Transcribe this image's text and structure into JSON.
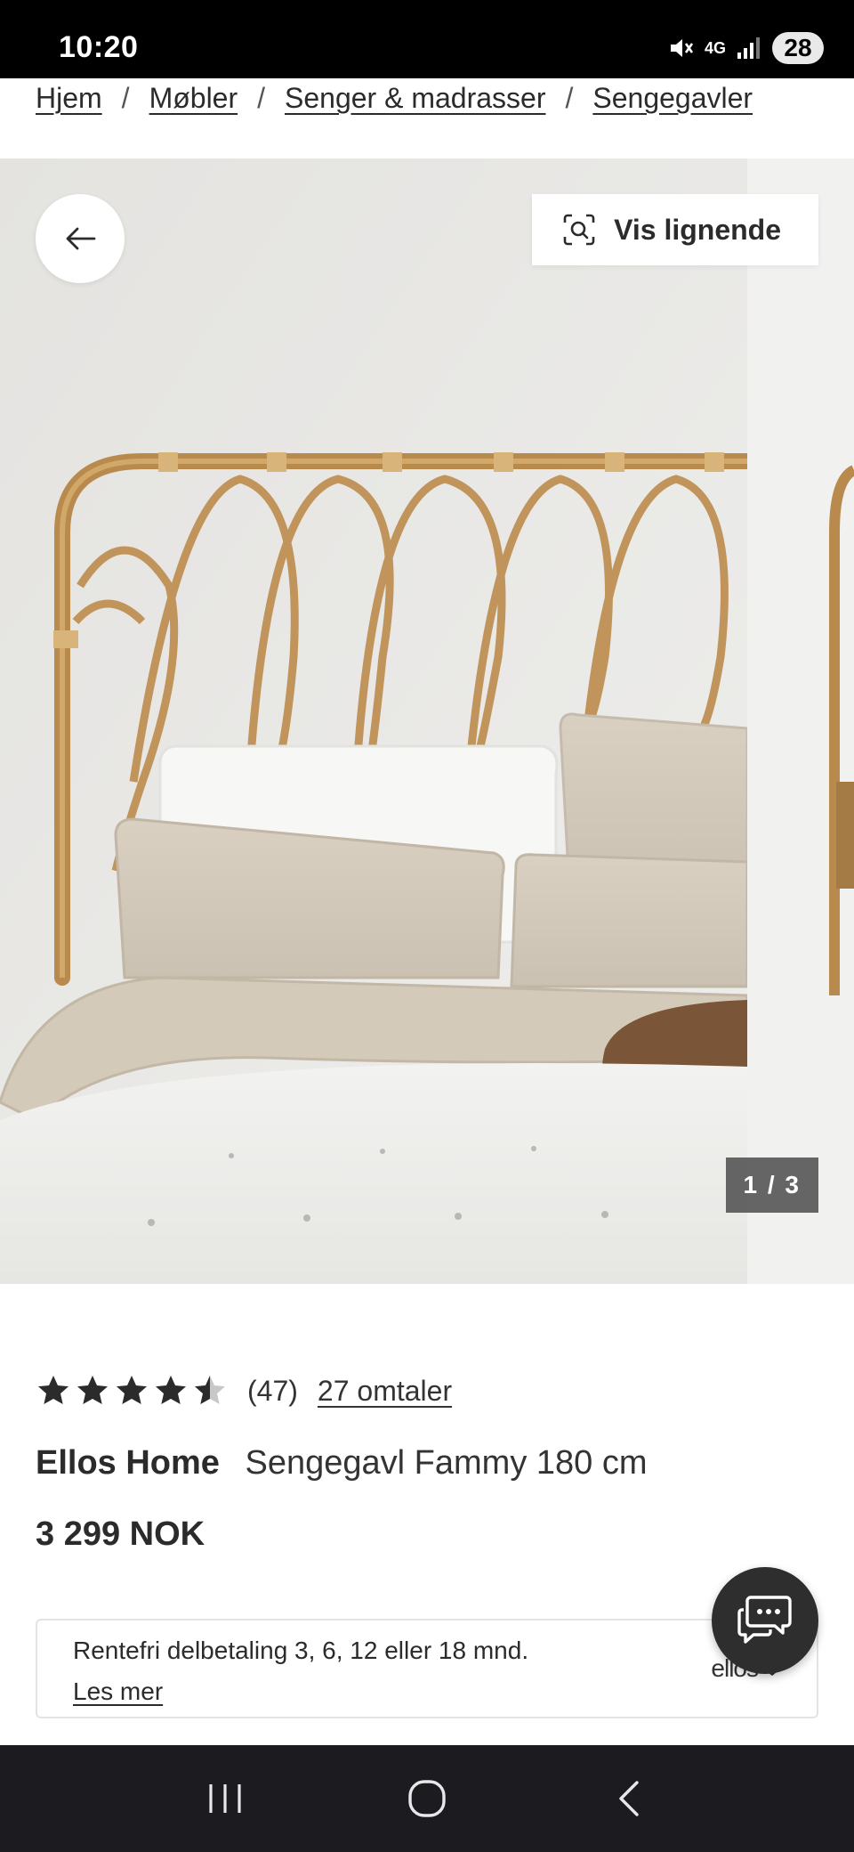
{
  "status_bar": {
    "time": "10:20",
    "network": "4G",
    "battery": "28"
  },
  "breadcrumb": {
    "items": [
      "Hjem",
      "Møbler",
      "Senger & madrasser",
      "Sengegavler"
    ],
    "separator": "/"
  },
  "gallery": {
    "back_icon": "arrow-left-icon",
    "similar_label": "Vis lignende",
    "similar_icon": "visual-search-icon",
    "counter": "1 / 3"
  },
  "product": {
    "rating_value": 4.5,
    "rating_max": 5,
    "rating_count": "(47)",
    "reviews_link": "27 omtaler",
    "brand": "Ellos Home",
    "name": "Sengegavl Fammy 180 cm",
    "price": "3 299 NOK"
  },
  "finance": {
    "text": "Rentefri delbetaling 3, 6, 12 eller 18 mnd.",
    "link": "Les mer",
    "logo": "ellos"
  },
  "chat": {
    "icon": "chat-bubble-icon"
  },
  "nav_bar": {
    "icons": [
      "recent-apps-icon",
      "home-icon",
      "back-icon"
    ]
  },
  "colors": {
    "text": "#2b2b2b",
    "rattan": "#b98a4e",
    "chat_bg": "#2e2e2e"
  }
}
